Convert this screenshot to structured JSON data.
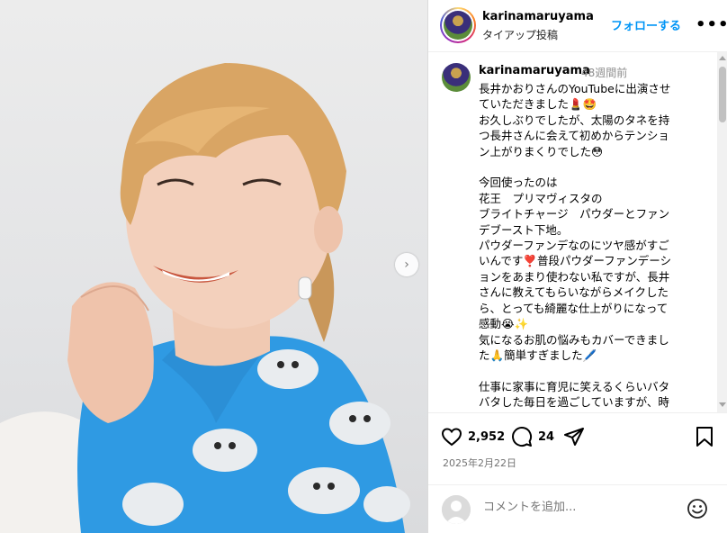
{
  "post": {
    "header": {
      "username": "karinamaruyama",
      "subtitle": "タイアップ投稿",
      "follow_label": "フォローする",
      "more_label": "•••"
    },
    "caption": {
      "username": "karinamaruyama",
      "time_ago": "48週間前",
      "text": "長井かおりさんのYouTubeに出演させていただきました💄🤩\nお久しぶりでしたが、太陽のタネを持つ長井さんに会えて初めからテンション上がりまくりでした😳\n\n今回使ったのは\n花王　プリマヴィスタの\nブライトチャージ　パウダーとファンデブースト下地。\nパウダーファンデなのにツヤ感がすごいんです❣️普段パウダーファンデーションをあまり使わない私ですが、長井さんに教えてもらいながらメイクしたら、とっても綺麗な仕上がりになって感動😭✨\n気になるお肌の悩みもカバーできました🙏簡単すぎました🖊️\n\n仕事に家事に育児に笑えるくらいバタバタした毎日を過ごしていますが、時"
    },
    "actions": {
      "likes": "2,952",
      "comments": "24",
      "date": "2025年2月22日"
    },
    "add_comment": {
      "placeholder": "コメントを追加..."
    },
    "icons": [
      "heart-icon",
      "comment-icon",
      "share-icon",
      "bookmark-icon",
      "emoji-icon",
      "chevron-right-icon",
      "more-icon"
    ]
  }
}
